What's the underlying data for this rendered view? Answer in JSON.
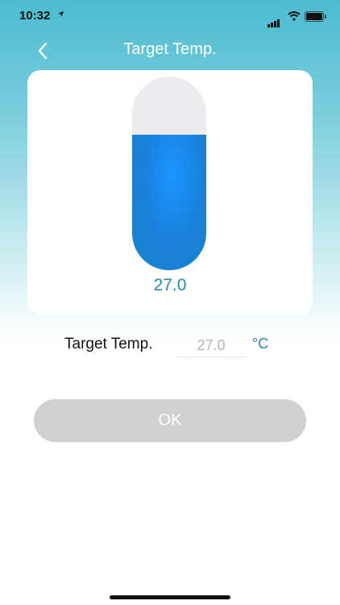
{
  "status_bar": {
    "time": "10:32"
  },
  "header": {
    "title": "Target Temp."
  },
  "thermometer": {
    "fill_fraction": 0.7,
    "value_label": "27.0"
  },
  "form": {
    "label": "Target Temp.",
    "input_value": "27.0",
    "unit": "°C"
  },
  "ok_button": {
    "label": "OK"
  },
  "colors": {
    "accent": "#2a88ad",
    "fill": "#1a88e6",
    "button_bg": "#d0d0d0",
    "header_bg": "#4bbbd0"
  },
  "icons": {
    "back": "chevron-left-icon",
    "location": "location-arrow-icon",
    "signal": "signal-icon",
    "wifi": "wifi-icon",
    "battery": "battery-icon"
  }
}
